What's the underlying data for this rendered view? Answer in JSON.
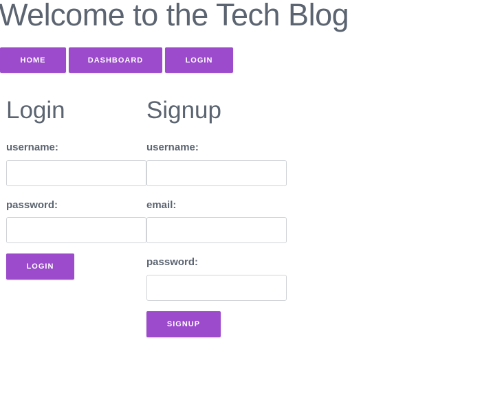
{
  "header": {
    "title": "Welcome to the Tech Blog"
  },
  "nav": {
    "home_label": "HOME",
    "dashboard_label": "DASHBOARD",
    "login_label": "LOGIN"
  },
  "login_form": {
    "heading": "Login",
    "username_label": "username:",
    "username_value": "",
    "password_label": "password:",
    "password_value": "",
    "submit_label": "LOGIN"
  },
  "signup_form": {
    "heading": "Signup",
    "username_label": "username:",
    "username_value": "",
    "email_label": "email:",
    "email_value": "",
    "password_label": "password:",
    "password_value": "",
    "submit_label": "SIGNUP"
  },
  "colors": {
    "accent": "#9b4bcb",
    "text": "#5b6470",
    "input_border": "#cfd3d7"
  }
}
